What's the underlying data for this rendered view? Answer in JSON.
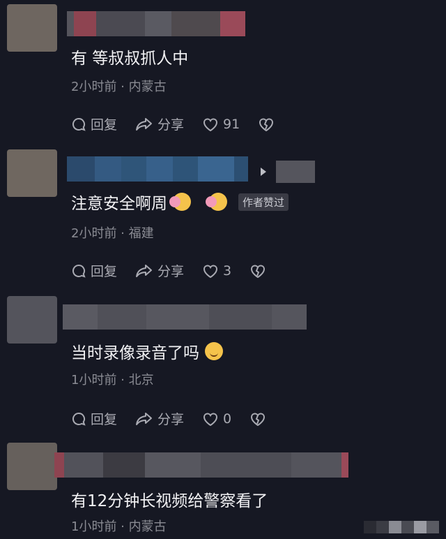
{
  "comments": [
    {
      "text": "有 等叔叔抓人中",
      "meta": "2小时前 · 内蒙古",
      "reply_label": "回复",
      "share_label": "分享",
      "like_count": "91",
      "emojis": [],
      "author_badge": ""
    },
    {
      "text": "注意安全啊周",
      "meta": "2小时前 · 福建",
      "reply_label": "回复",
      "share_label": "分享",
      "like_count": "3",
      "emojis": [
        "couple-emoji",
        "couple-emoji"
      ],
      "author_badge": "作者赞过"
    },
    {
      "text": "当时录像录音了吗",
      "meta": "1小时前 · 北京",
      "reply_label": "回复",
      "share_label": "分享",
      "like_count": "0",
      "emojis": [
        "smile-emoji"
      ],
      "author_badge": ""
    },
    {
      "text": "有12分钟长视频给警察看了",
      "meta": "1小时前 · 内蒙古",
      "emojis": [],
      "author_badge": ""
    }
  ],
  "icons": {
    "reply": "reply-bubble-icon",
    "share": "share-arrow-icon",
    "like": "heart-icon",
    "dislike": "broken-heart-icon"
  },
  "colors": {
    "background": "#161823",
    "text": "#f2f2f4",
    "meta": "#8a8b93"
  }
}
